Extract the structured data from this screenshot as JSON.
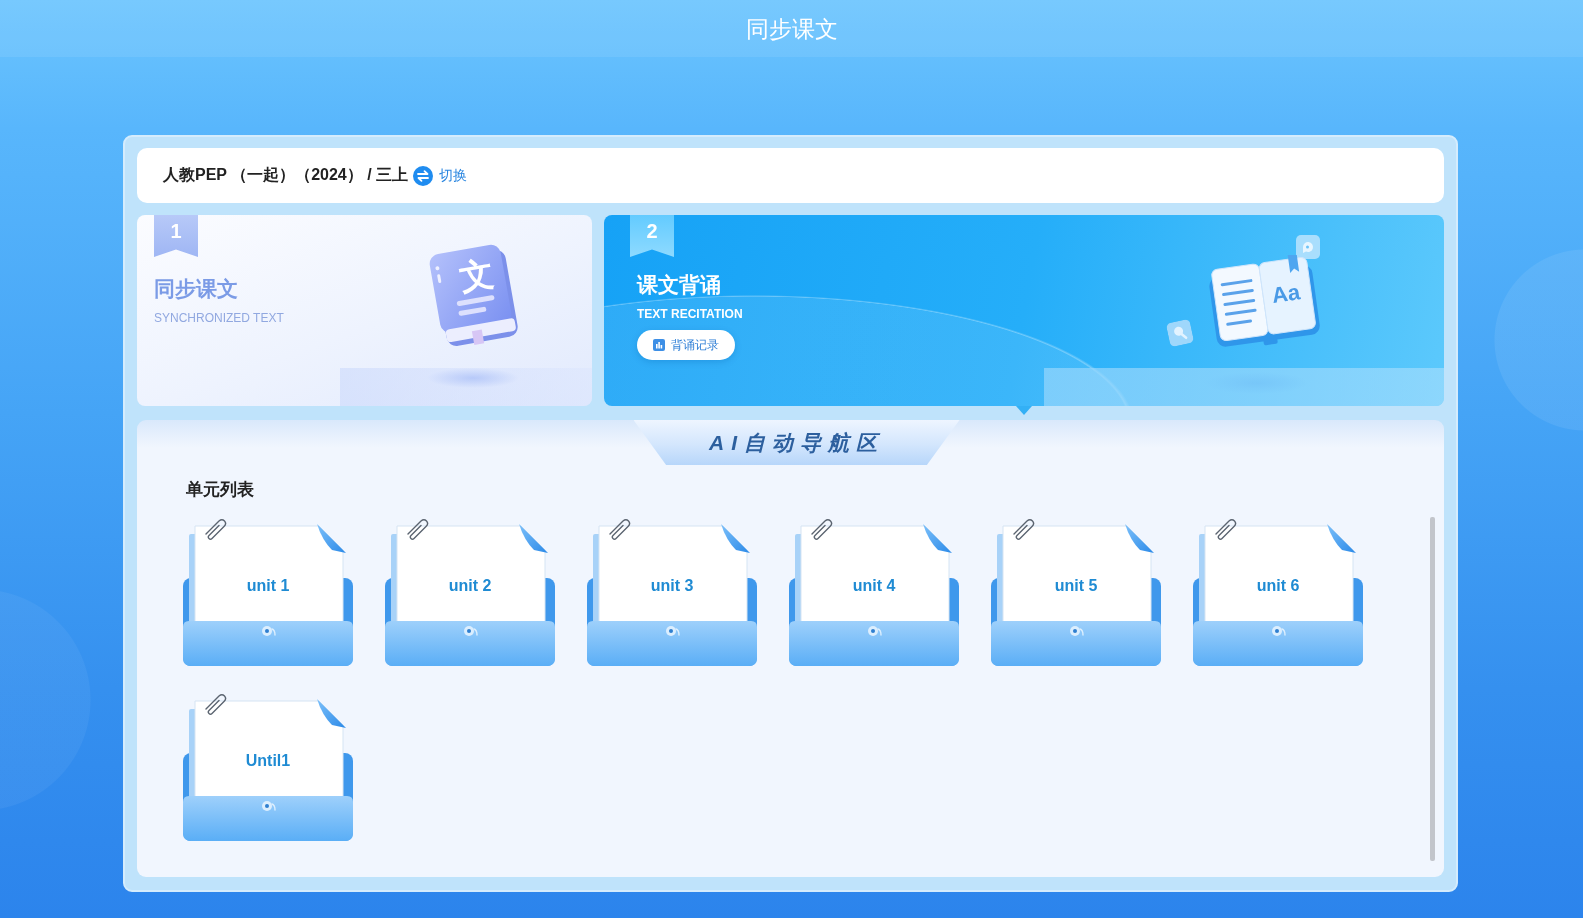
{
  "header": {
    "title": "同步课文"
  },
  "breadcrumb": {
    "path": "人教PEP （一起）（2024） / 三上",
    "switch_label": "切换"
  },
  "modes": [
    {
      "number": "1",
      "title": "同步课文",
      "subtitle": "SYNCHRONIZED TEXT",
      "selected": false,
      "illustration": {
        "kind": "book",
        "glyph": "文"
      }
    },
    {
      "number": "2",
      "title": "课文背诵",
      "subtitle": "TEXT RECITATION",
      "selected": true,
      "button": "背诵记录",
      "illustration": {
        "kind": "open_book",
        "glyph": "Aa"
      }
    }
  ],
  "navigation": {
    "banner": "AI自动导航区",
    "section_title": "单元列表",
    "units": [
      {
        "label": "unit 1"
      },
      {
        "label": "unit 2"
      },
      {
        "label": "unit 3"
      },
      {
        "label": "unit 4"
      },
      {
        "label": "unit 5"
      },
      {
        "label": "unit 6"
      },
      {
        "label": "Until1"
      }
    ]
  }
}
